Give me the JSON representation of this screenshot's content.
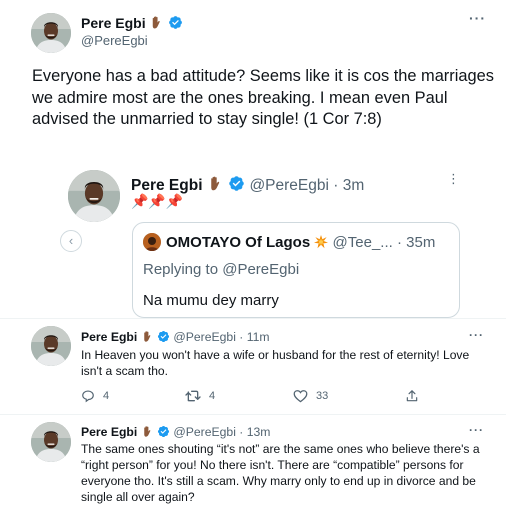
{
  "main_tweet": {
    "name": "Pere Egbi",
    "handle": "@PereEgbi",
    "text": "Everyone has a bad attitude? Seems like it is cos the marriages we admire most are the ones breaking. I mean even Paul advised the unmarried to stay single! (1 Cor 7:8)",
    "more_label": "···"
  },
  "quoted_tweet": {
    "name": "Pere Egbi",
    "handle": "@PereEgbi",
    "time": "· 3m",
    "pins": "📌📌📌",
    "more_label": "⋮",
    "prev_label": "‹",
    "nested": {
      "name": "OMOTAYO Of Lagos",
      "handle": "@Tee_...",
      "time": "· 35m",
      "replying_to": "Replying to @PereEgbi",
      "text": "Na mumu dey marry"
    }
  },
  "replies": [
    {
      "name": "Pere Egbi",
      "handle": "@PereEgbi",
      "time": "· 11m",
      "text": "In Heaven you won't have a wife or husband for the rest of eternity! Love isn't a scam tho.",
      "comments": "4",
      "retweets": "4",
      "likes": "33",
      "more_label": "···"
    },
    {
      "name": "Pere Egbi",
      "handle": "@PereEgbi",
      "time": "· 13m",
      "text": "The same ones shouting “it's not” are the same ones who believe there's a “right person” for you! No there isn't. There are “compatible” persons for everyone tho. It's still a scam. Why marry only to end up in divorce and be single all over again?",
      "more_label": "···"
    }
  ],
  "icons": {
    "verified": "verified-badge-icon",
    "raised_hand": "raised-hand-emoji-icon",
    "comment": "comment-icon",
    "retweet": "retweet-icon",
    "like": "heart-icon",
    "share": "share-icon",
    "collision": "collision-emoji-icon"
  },
  "colors": {
    "verified_blue": "#1d9bf0",
    "text": "#0f1419",
    "muted": "#536471",
    "border": "#cfd9de"
  }
}
